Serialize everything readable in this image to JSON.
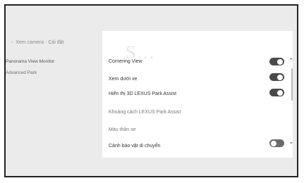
{
  "breadcrumb": {
    "back_icon": "chevron-left-icon",
    "text": "Xem camera · Cài đặt"
  },
  "sidebar": {
    "items": [
      {
        "label": "Panorama View Monitor",
        "selected": true
      },
      {
        "label": "Advanced Park",
        "selected": false
      }
    ]
  },
  "panel": {
    "ghost_text": "S...",
    "rows": [
      {
        "label": "Cornering View",
        "toggle": "on"
      },
      {
        "label": "Xem dưới xe",
        "toggle": "on"
      },
      {
        "label": "Hiển thị 3D LEXUS Park Assist",
        "toggle": "on"
      },
      {
        "label": "Khoảng cách LEXUS Park Assist",
        "toggle": null
      },
      {
        "label": "Màu thân xe",
        "toggle": null
      },
      {
        "label": "Cảnh báo vật di chuyển",
        "toggle": "off"
      }
    ]
  },
  "scroll": {
    "up_icon": "chevron-up-icon",
    "down_icon": "chevron-down-icon"
  },
  "colors": {
    "background": "#ebebeb",
    "panel": "#ffffff",
    "toggle_on": "#4a4a4a",
    "text": "#333333"
  }
}
